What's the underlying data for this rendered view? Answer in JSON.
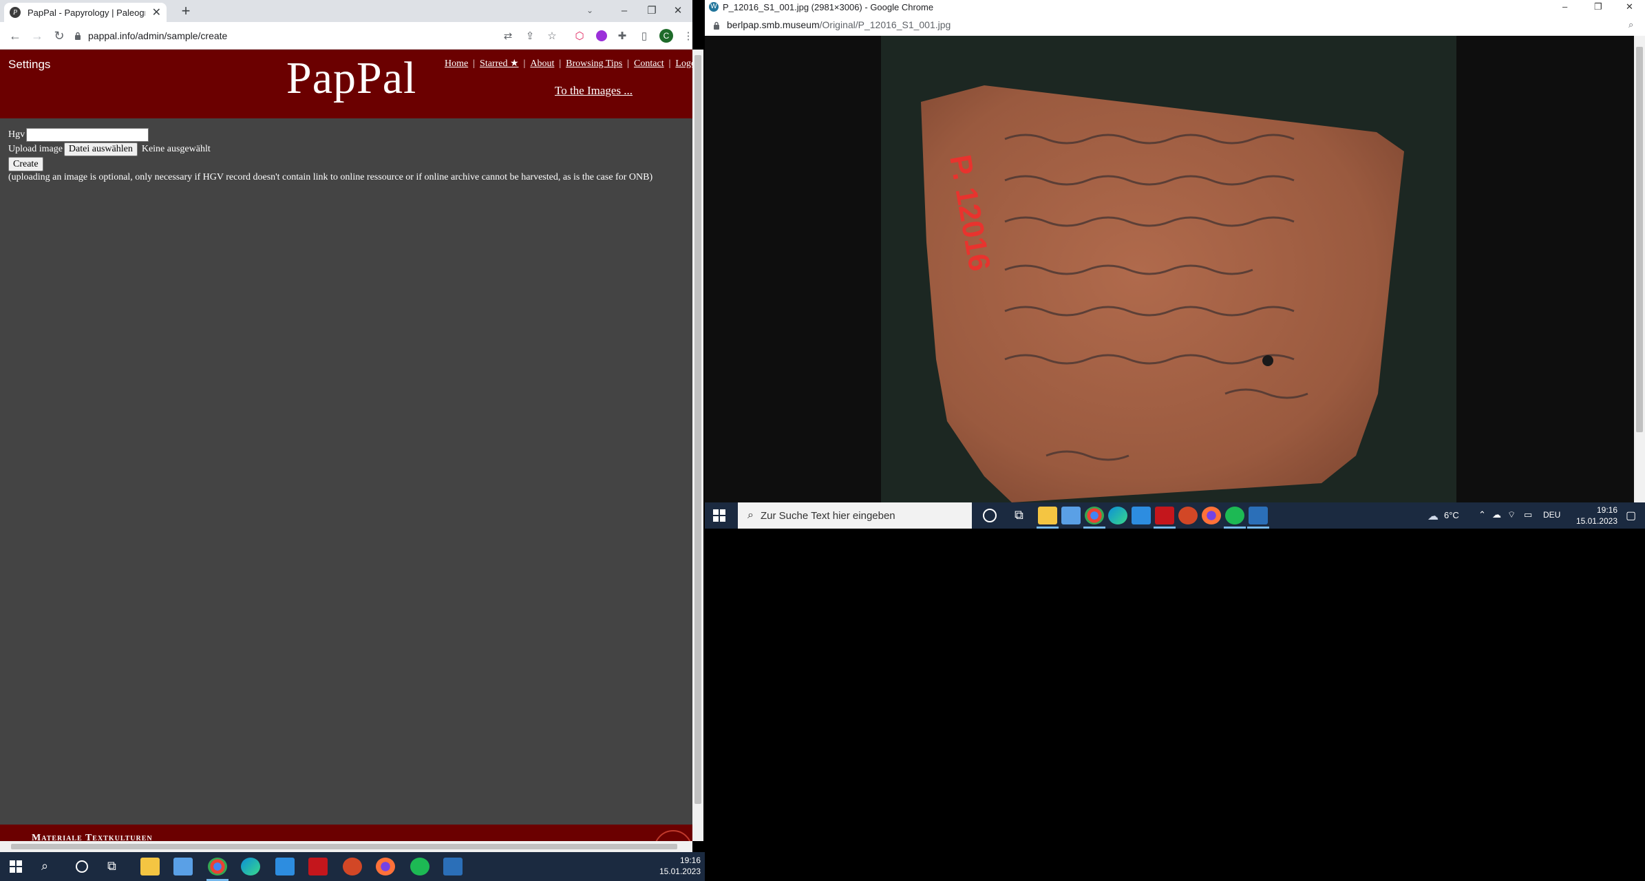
{
  "left_window": {
    "tab_title": "PapPal - Papyrology | Paleography",
    "tab_favicon_letter": "P",
    "url": "pappal.info/admin/sample/create",
    "profile_initial": "C"
  },
  "pappal": {
    "settings": "Settings",
    "logo": "PapPal",
    "nav": [
      {
        "label": "Home"
      },
      {
        "label": "Starred ★"
      },
      {
        "label": "About"
      },
      {
        "label": "Browsing Tips"
      },
      {
        "label": "Contact"
      },
      {
        "label": "Logout"
      }
    ],
    "to_images": "To the Images ...",
    "form": {
      "hgv_label": "Hgv",
      "hgv_value": "",
      "upload_label": "Upload image",
      "file_button": "Datei auswählen",
      "file_status": "Keine ausgewählt",
      "create_button": "Create",
      "note": "(uploading an image is optional, only necessary if HGV record doesn't contain link to online ressource or if online archive cannot be harvested, as is the case for ONB)"
    },
    "footer": "Materiale Textkulturen"
  },
  "right_window": {
    "title": "P_12016_S1_001.jpg (2981×3006) - Google Chrome",
    "url_host": "berlpap.smb.museum",
    "url_path": "/Original/P_12016_S1_001.jpg",
    "image_label": "P. 12016"
  },
  "taskbar_right": {
    "search_placeholder": "Zur Suche Text hier eingeben",
    "weather": "6°C",
    "language": "DEU",
    "time": "19:16",
    "date": "15.01.2023"
  },
  "taskbar_left": {
    "time": "19:16",
    "date": "15.01.2023"
  },
  "colors": {
    "pappal_red": "#6b0000",
    "page_bg": "#444444",
    "taskbar": "#1b2a40"
  }
}
